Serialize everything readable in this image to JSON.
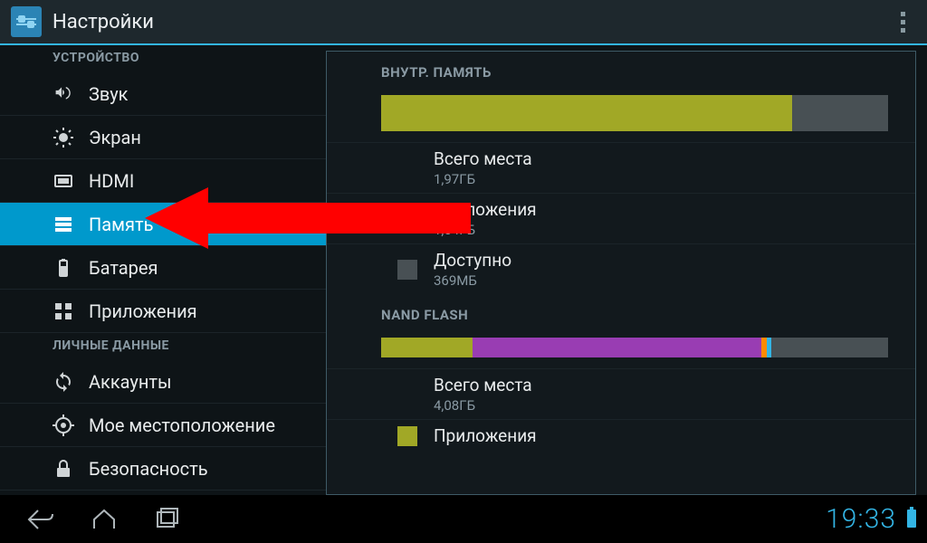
{
  "actionbar": {
    "title": "Настройки"
  },
  "sidebar": {
    "section_device": "УСТРОЙСТВО",
    "section_personal": "ЛИЧНЫЕ ДАННЫЕ",
    "items": {
      "sound": "Звук",
      "display": "Экран",
      "hdmi": "HDMI",
      "storage": "Память",
      "battery": "Батарея",
      "apps": "Приложения",
      "accounts": "Аккаунты",
      "location": "Мое местоположение",
      "security": "Безопасность"
    }
  },
  "storage": {
    "internal": {
      "header": "ВНУТР. ПАМЯТЬ",
      "bar": {
        "used_percent": 81,
        "used_color": "#a1a826",
        "free_color": "#485054"
      },
      "rows": [
        {
          "swatch": "",
          "title": "Всего места",
          "value": "1,97ГБ"
        },
        {
          "swatch": "#a1a826",
          "title": "Приложения",
          "value": "1,54ГБ"
        },
        {
          "swatch": "#485054",
          "title": "Доступно",
          "value": "369МБ"
        }
      ]
    },
    "nand": {
      "header": "NAND FLASH",
      "bar_segments": [
        {
          "color": "#a1a826",
          "percent": 18
        },
        {
          "color": "#993db3",
          "percent": 57
        },
        {
          "color": "#ff8a00",
          "percent": 1
        },
        {
          "color": "#33b5e5",
          "percent": 1
        },
        {
          "color": "#485054",
          "percent": 23
        }
      ],
      "rows": [
        {
          "swatch": "",
          "title": "Всего места",
          "value": "4,08ГБ"
        },
        {
          "swatch": "#a1a826",
          "title": "Приложения",
          "value": ""
        }
      ]
    }
  },
  "navbar": {
    "clock": "19:33"
  },
  "colors": {
    "accent": "#33b5e5",
    "olive": "#a1a826",
    "purple": "#993db3"
  }
}
